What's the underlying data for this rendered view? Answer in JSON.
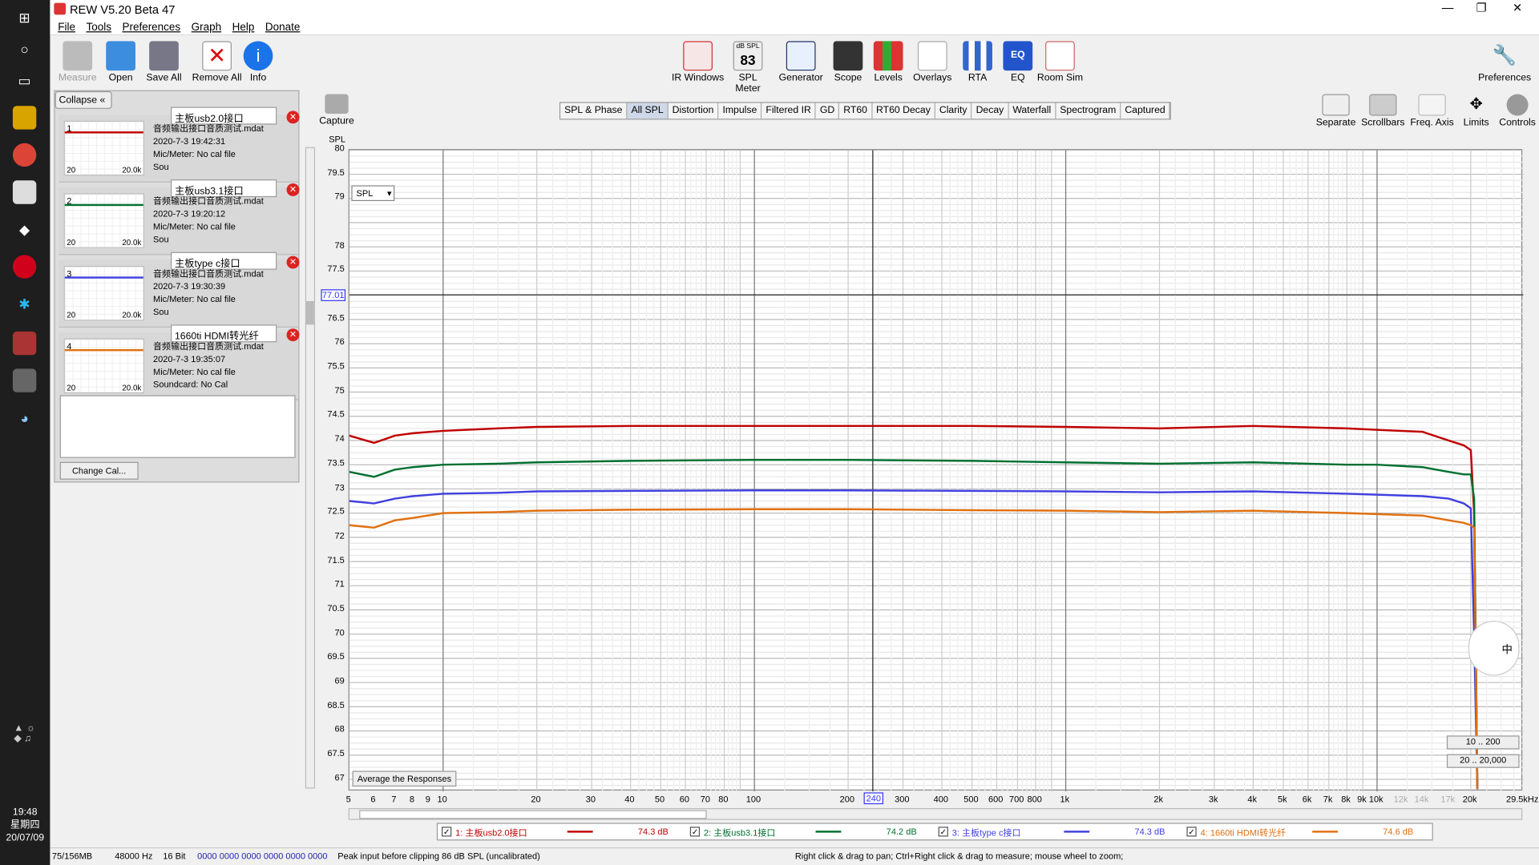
{
  "app": {
    "title": "REW V5.20 Beta 47",
    "menus": [
      "File",
      "Tools",
      "Preferences",
      "Graph",
      "Help",
      "Donate"
    ]
  },
  "toolbar_left": [
    "Measure",
    "Open",
    "Save All",
    "Remove All",
    "Info"
  ],
  "toolbar_center": [
    "IR Windows",
    "SPL Meter",
    "Generator",
    "Scope",
    "Levels",
    "Overlays",
    "RTA",
    "EQ",
    "Room Sim"
  ],
  "spl_meter_badge": {
    "top": "dB SPL",
    "value": "83"
  },
  "toolbar_right": "Preferences",
  "capture": "Capture",
  "tabs": [
    "SPL & Phase",
    "All SPL",
    "Distortion",
    "Impulse",
    "Filtered IR",
    "GD",
    "RT60",
    "RT60 Decay",
    "Clarity",
    "Decay",
    "Waterfall",
    "Spectrogram",
    "Captured"
  ],
  "graph_tools": [
    "Separate",
    "Scrollbars",
    "Freq. Axis",
    "Limits",
    "Controls"
  ],
  "collapse": "Collapse",
  "measurements": [
    {
      "num": "1",
      "name": "主板usb2.0接口",
      "file": "音频输出接口音质测试.mdat",
      "date": "2020-7-3 19:42:31",
      "mic": "Mic/Meter: No cal file",
      "extra": "Sou",
      "color": "#c00000",
      "ax0": "20",
      "ax1": "20.0k"
    },
    {
      "num": "2",
      "name": "主板usb3.1接口",
      "file": "音频输出接口音质测试.mdat",
      "date": "2020-7-3 19:20:12",
      "mic": "Mic/Meter: No cal file",
      "extra": "Sou",
      "color": "#007030",
      "ax0": "20",
      "ax1": "20.0k"
    },
    {
      "num": "3",
      "name": "主板type c接口",
      "file": "音频输出接口音质测试.mdat",
      "date": "2020-7-3 19:30:39",
      "mic": "Mic/Meter: No cal file",
      "extra": "Sou",
      "color": "#4040e0",
      "ax0": "20",
      "ax1": "20.0k"
    },
    {
      "num": "4",
      "name": "1660ti HDMI转光纤",
      "file": "音频输出接口音质测试.mdat",
      "date": "2020-7-3 19:35:07",
      "mic": "Mic/Meter: No cal file",
      "extra": "Soundcard: No Cal",
      "color": "#e07010",
      "ax0": "20",
      "ax1": "20.0k"
    }
  ],
  "change_cal": "Change Cal...",
  "plot": {
    "ylabel": "SPL",
    "ytop": 80,
    "ybottom": 66.75,
    "yticks": [
      "80",
      "79.5",
      "79",
      "78",
      "77.5",
      "77",
      "76.5",
      "76",
      "75.5",
      "75",
      "74.5",
      "74",
      "73.5",
      "73",
      "72.5",
      "72",
      "71.5",
      "71",
      "70.5",
      "70",
      "69.5",
      "69",
      "68.5",
      "68",
      "67.5",
      "67"
    ],
    "cursor_y": "77.01",
    "cursor_x": "240",
    "selector": "SPL",
    "avg_button": "Average the Responses",
    "xticks": [
      "5",
      "6",
      "7",
      "8",
      "9",
      "10",
      "20",
      "30",
      "40",
      "50",
      "60",
      "70",
      "80",
      "100",
      "200",
      "300",
      "400",
      "500",
      "600",
      "700",
      "800",
      "1k",
      "2k",
      "3k",
      "4k",
      "5k",
      "6k",
      "7k",
      "8k",
      "9k",
      "10k",
      "12k",
      "14k",
      "17k",
      "20k",
      "29.5kHz"
    ],
    "range_buttons": [
      "10 .. 200",
      "20 .. 20,000"
    ]
  },
  "chart_data": {
    "type": "line",
    "xlabel": "",
    "ylabel": "SPL",
    "xscale": "log",
    "xlim": [
      5,
      29500
    ],
    "ylim": [
      66.75,
      80
    ],
    "x": [
      5,
      6,
      7,
      8,
      10,
      15,
      20,
      40,
      100,
      200,
      500,
      1000,
      2000,
      4000,
      8000,
      10000,
      14000,
      17000,
      19000,
      20000,
      20500,
      21000
    ],
    "series": [
      {
        "name": "1: 主板usb2.0接口",
        "color": "#c00000",
        "values": [
          74.1,
          73.95,
          74.1,
          74.15,
          74.2,
          74.25,
          74.28,
          74.3,
          74.3,
          74.3,
          74.3,
          74.28,
          74.25,
          74.3,
          74.25,
          74.22,
          74.18,
          74.0,
          73.9,
          73.8,
          72.5,
          66.8
        ]
      },
      {
        "name": "2: 主板usb3.1接口",
        "color": "#007030",
        "values": [
          73.35,
          73.25,
          73.4,
          73.45,
          73.5,
          73.52,
          73.55,
          73.58,
          73.6,
          73.6,
          73.58,
          73.55,
          73.52,
          73.55,
          73.5,
          73.5,
          73.45,
          73.35,
          73.3,
          73.3,
          72.8,
          66.8
        ]
      },
      {
        "name": "3: 主板type c接口",
        "color": "#4040e0",
        "values": [
          72.75,
          72.7,
          72.8,
          72.85,
          72.9,
          72.92,
          72.95,
          72.96,
          72.97,
          72.97,
          72.96,
          72.95,
          72.93,
          72.95,
          72.9,
          72.88,
          72.85,
          72.8,
          72.7,
          72.6,
          70.0,
          66.8
        ]
      },
      {
        "name": "4: 1660ti HDMI转光纤",
        "color": "#e07010",
        "values": [
          72.25,
          72.2,
          72.35,
          72.4,
          72.5,
          72.52,
          72.55,
          72.57,
          72.58,
          72.58,
          72.56,
          72.55,
          72.52,
          72.55,
          72.5,
          72.48,
          72.45,
          72.35,
          72.3,
          72.25,
          72.2,
          66.8
        ]
      }
    ]
  },
  "legend": [
    {
      "label": "1: 主板usb2.0接口",
      "value": "74.3 dB",
      "color": "#c00000"
    },
    {
      "label": "2: 主板usb3.1接口",
      "value": "74.2 dB",
      "color": "#007030"
    },
    {
      "label": "3: 主板type c接口",
      "value": "74.3 dB",
      "color": "#4040e0"
    },
    {
      "label": "4: 1660ti HDMI转光纤",
      "value": "74.6 dB",
      "color": "#e07010"
    }
  ],
  "status": {
    "memory": "75/156MB",
    "rate": "48000 Hz",
    "bits": "16 Bit",
    "hex": "0000 0000  0000 0000  0000 0000",
    "peak": "Peak input before clipping 86 dB SPL (uncalibrated)",
    "hint": "Right click & drag to pan; Ctrl+Right click & drag to measure; mouse wheel to zoom;"
  },
  "taskbar": {
    "time": "19:48",
    "day": "星期四",
    "date": "20/07/09"
  }
}
